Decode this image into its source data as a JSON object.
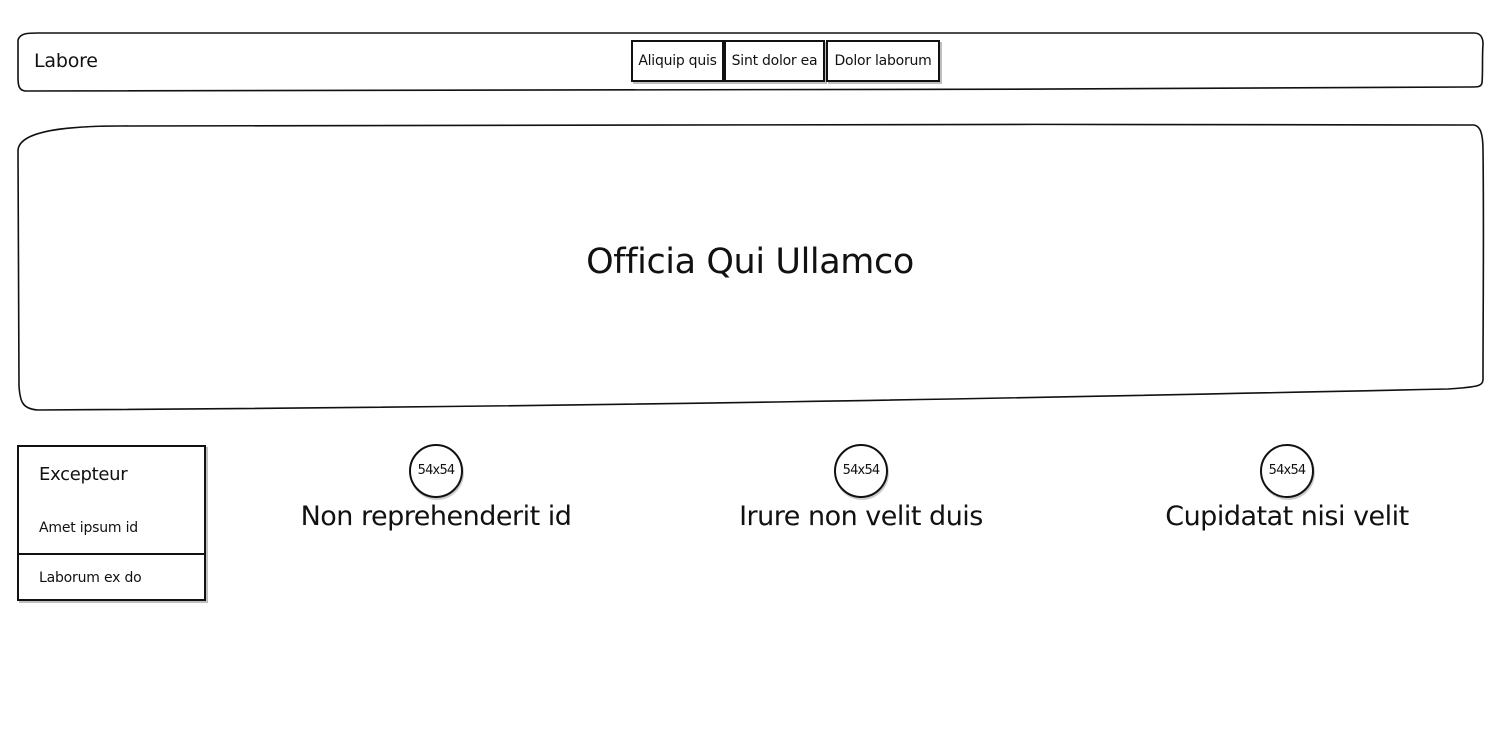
{
  "navbar": {
    "title": "Labore",
    "buttons": [
      {
        "label": "Aliquip quis"
      },
      {
        "label": "Sint dolor ea"
      },
      {
        "label": "Dolor laborum"
      }
    ]
  },
  "hero": {
    "title": "Officia Qui Ullamco"
  },
  "sidebar": {
    "heading": "Excepteur",
    "items": [
      {
        "label": "Amet ipsum id"
      },
      {
        "label": "Laborum ex do"
      }
    ]
  },
  "features": [
    {
      "image_label": "54x54",
      "title": "Non reprehenderit id"
    },
    {
      "image_label": "54x54",
      "title": "Irure non velit duis"
    },
    {
      "image_label": "54x54",
      "title": "Cupidatat nisi velit"
    }
  ],
  "colors": {
    "line": "#111111",
    "background": "#ffffff"
  }
}
